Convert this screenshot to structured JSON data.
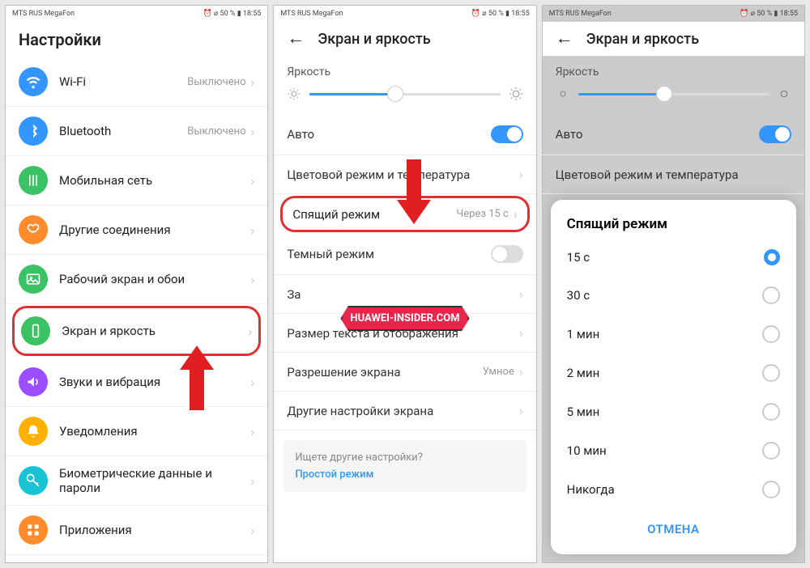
{
  "status": {
    "left": "MTS RUS  MegaFon",
    "right": "⏰ ⌀ 50 % ▮ 18:55"
  },
  "screen1": {
    "title": "Настройки",
    "items": [
      {
        "label": "Wi-Fi",
        "val": "Выключено",
        "color": "#3396ff",
        "icon": "wifi"
      },
      {
        "label": "Bluetooth",
        "val": "Выключено",
        "color": "#3396ff",
        "icon": "bt"
      },
      {
        "label": "Мобильная сеть",
        "val": "",
        "color": "#3ac264",
        "icon": "sim"
      },
      {
        "label": "Другие соединения",
        "val": "",
        "color": "#ff8b2c",
        "icon": "link"
      },
      {
        "label": "Рабочий экран и обои",
        "val": "",
        "color": "#3ac264",
        "icon": "img"
      },
      {
        "label": "Экран и яркость",
        "val": "",
        "color": "#3ac264",
        "icon": "disp",
        "hl": true
      },
      {
        "label": "Звуки и вибрация",
        "val": "",
        "color": "#9b4dff",
        "icon": "snd"
      },
      {
        "label": "Уведомления",
        "val": "",
        "color": "#ffb000",
        "icon": "bell"
      },
      {
        "label": "Биометрические данные и пароли",
        "val": "",
        "color": "#17c3d4",
        "icon": "key"
      },
      {
        "label": "Приложения",
        "val": "",
        "color": "#ff8b2c",
        "icon": "apps"
      }
    ]
  },
  "screen2": {
    "title": "Экран и яркость",
    "brightness": "Яркость",
    "auto": "Авто",
    "rows": [
      {
        "label": "Цветовой режим и температура"
      },
      {
        "label": "Спящий режим",
        "val": "Через 15 с",
        "hl": true
      },
      {
        "label": "Темный режим",
        "toggle": "off"
      },
      {
        "label": "За",
        "hidden": true
      },
      {
        "label": "Размер текста и отображения"
      },
      {
        "label": "Разрешение экрана",
        "val": "Умное"
      },
      {
        "label": "Другие настройки экрана"
      }
    ],
    "hint_q": "Ищете другие настройки?",
    "hint_a": "Простой режим",
    "badge": "HUAWEI-INSIDER.COM"
  },
  "screen3": {
    "title": "Экран и яркость",
    "brightness": "Яркость",
    "auto": "Авто",
    "row": "Цветовой режим и температура",
    "modal_title": "Спящий режим",
    "options": [
      "15 с",
      "30 с",
      "1 мин",
      "2 мин",
      "5 мин",
      "10 мин",
      "Никогда"
    ],
    "selected": 0,
    "cancel": "ОТМЕНА"
  }
}
